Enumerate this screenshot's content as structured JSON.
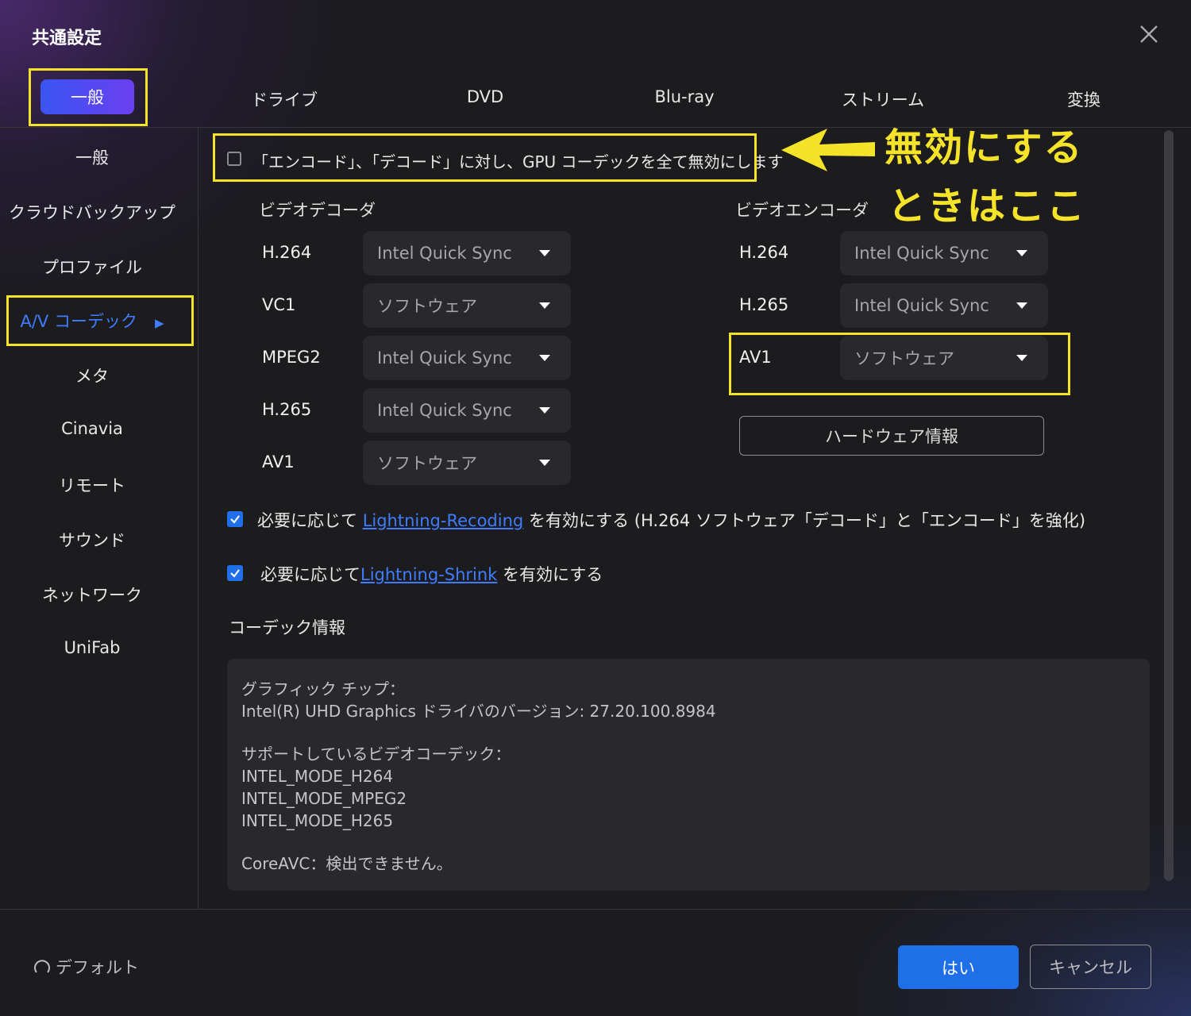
{
  "window": {
    "title": "共通設定"
  },
  "icons": {
    "close": "close-icon",
    "arrow": "left-arrow-icon",
    "refresh": "refresh-icon",
    "check": "check-icon"
  },
  "colors": {
    "accent": "#1f6fe8",
    "annotation": "#f5e32a",
    "active_nav": "#3f7cff"
  },
  "top_tabs": {
    "general": "一般",
    "drive": "ドライブ",
    "dvd": "DVD",
    "bluray": "Blu-ray",
    "stream": "ストリーム",
    "convert": "変換"
  },
  "sidebar": {
    "items": [
      {
        "label": "一般"
      },
      {
        "label": "クラウドバックアップ"
      },
      {
        "label": "プロファイル"
      },
      {
        "label": "A/V コーデック",
        "active": true
      },
      {
        "label": "メタ"
      },
      {
        "label": "Cinavia"
      },
      {
        "label": "リモート"
      },
      {
        "label": "サウンド"
      },
      {
        "label": "ネットワーク"
      },
      {
        "label": "UniFab"
      }
    ]
  },
  "gpu_disable": {
    "checked": false,
    "label": "「エンコード」、「デコード」に対し、GPU コーデックを全て無効にします"
  },
  "annotation": {
    "line1": "無効にする",
    "line2": "ときはここ"
  },
  "decoder": {
    "title": "ビデオデコーダ",
    "rows": [
      {
        "codec": "H.264",
        "value": "Intel Quick Sync"
      },
      {
        "codec": "VC1",
        "value": "ソフトウェア"
      },
      {
        "codec": "MPEG2",
        "value": "Intel Quick Sync"
      },
      {
        "codec": "H.265",
        "value": "Intel Quick Sync"
      },
      {
        "codec": "AV1",
        "value": "ソフトウェア"
      }
    ]
  },
  "encoder": {
    "title": "ビデオエンコーダ",
    "rows": [
      {
        "codec": "H.264",
        "value": "Intel Quick Sync"
      },
      {
        "codec": "H.265",
        "value": "Intel Quick Sync"
      },
      {
        "codec": "AV1",
        "value": "ソフトウェア"
      }
    ],
    "hardware_button": "ハードウェア情報"
  },
  "options": {
    "recoding": {
      "checked": true,
      "prefix": "必要に応じて",
      "link": "Lightning-Recoding",
      "suffix": "を有効にする (H.264 ソフトウェア「デコード」と「エンコード」を強化)"
    },
    "shrink": {
      "checked": true,
      "prefix": "必要に応じて",
      "link": "Lightning-Shrink",
      "suffix": "を有効にする"
    }
  },
  "codec_info": {
    "title": "コーデック情報",
    "graphics_chip_label": "グラフィック チップ：",
    "driver_line": "Intel(R) UHD Graphics ドライバのバージョン: 27.20.100.8984",
    "supported_label": "サポートしているビデオコーデック：",
    "supported": [
      "INTEL_MODE_H264",
      "INTEL_MODE_MPEG2",
      "INTEL_MODE_H265"
    ],
    "coreavc": "CoreAVC：検出できません。"
  },
  "footer": {
    "default_label": "デフォルト",
    "yes_label": "はい",
    "cancel_label": "キャンセル"
  }
}
